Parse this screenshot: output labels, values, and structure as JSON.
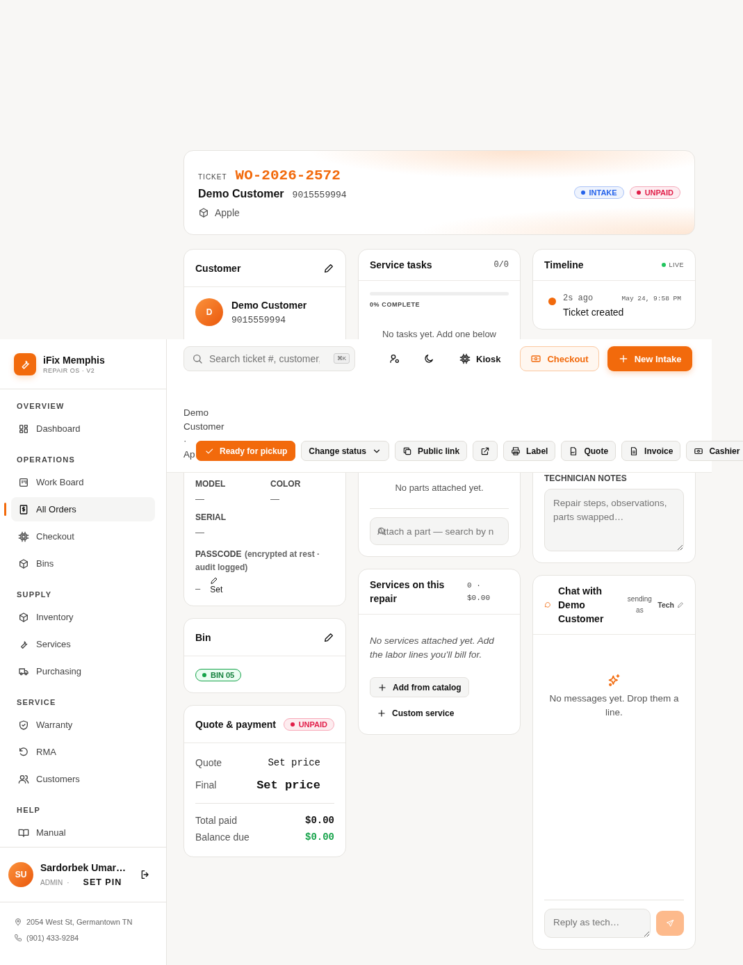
{
  "ticket": {
    "label": "TICKET",
    "number": "WO-2026-2572",
    "customer": "Demo Customer",
    "phone": "9015559994",
    "brand": "Apple",
    "badges": [
      {
        "text": "INTAKE",
        "color": "#2563eb"
      },
      {
        "text": "UNPAID",
        "color": "#e11d48"
      }
    ]
  },
  "customer_card": {
    "title": "Customer",
    "avatar": "D",
    "name": "Demo Customer",
    "phone": "9015559994",
    "fields": [
      {
        "label": "MODEL",
        "value": "—"
      },
      {
        "label": "COLOR",
        "value": "—"
      },
      {
        "label": "SERIAL",
        "value": "—"
      }
    ],
    "passcode": {
      "label": "PASSCODE",
      "note": "(encrypted at rest · audit logged)",
      "value": "–",
      "action": "Set"
    }
  },
  "tasks_card": {
    "title": "Service tasks",
    "count": "0/0",
    "level": 0,
    "progress_label": "0% COMPLETE",
    "empty": "No tasks yet. Add one below",
    "parts_empty": "No parts attached yet.",
    "parts_placeholder": "Attach a part — search by n"
  },
  "timeline": {
    "title": "Timeline",
    "live": "LIVE",
    "events": [
      {
        "ago": "2s ago",
        "time": "May 24, 9:58 PM",
        "text": "Ticket created"
      }
    ]
  },
  "notes": {
    "label": "TECHNICIAN NOTES",
    "placeholder": "Repair steps, observations, parts swapped…"
  },
  "bin": {
    "title": "Bin",
    "tag": "BIN 05"
  },
  "quote": {
    "title": "Quote & payment",
    "badge": "UNPAID",
    "rows": [
      {
        "label": "Quote",
        "value": "Set price",
        "kind": "plain"
      },
      {
        "label": "Final",
        "value": "Set price",
        "kind": "strong"
      }
    ],
    "totals": [
      {
        "label": "Total paid",
        "value": "$0.00",
        "kind": "plain"
      },
      {
        "label": "Balance due",
        "value": "$0.00",
        "kind": "positive"
      }
    ]
  },
  "services": {
    "title": "Services on this repair",
    "count": "0",
    "separator": "·",
    "total": "$0.00",
    "empty": "No services attached yet. Add the labor lines you'll bill for.",
    "actions": [
      {
        "label": "Add from catalog",
        "kind": "outlined"
      },
      {
        "label": "Custom service",
        "kind": "plain"
      }
    ]
  },
  "chat": {
    "title": "Chat with Demo Customer",
    "sending_label": "sending as",
    "sender": "Tech",
    "empty": "No messages yet. Drop them a line.",
    "placeholder": "Reply as tech…"
  },
  "topbar": {
    "search_placeholder": "Search ticket #, customer,",
    "shortcut": "⌘K",
    "kiosk": "Kiosk",
    "checkout": "Checkout",
    "new_intake": "New Intake",
    "breadcrumb": [
      "Demo Customer",
      "·",
      "Ap"
    ],
    "actions": [
      {
        "label": "Ready for pickup",
        "kind": "primary"
      },
      {
        "label": "Change status",
        "kind": "dropdown"
      },
      {
        "label": "Public link",
        "kind": "default"
      },
      {
        "kind": "icon"
      },
      {
        "label": "Label",
        "kind": "default"
      },
      {
        "label": "Quote",
        "kind": "default"
      },
      {
        "label": "Invoice",
        "kind": "default"
      },
      {
        "label": "Cashier",
        "kind": "default"
      }
    ]
  },
  "sidebar": {
    "brand": "iFix Memphis",
    "subtitle": "REPAIR OS · V2",
    "sections": [
      {
        "title": "OVERVIEW",
        "items": [
          {
            "label": "Dashboard",
            "selected": false
          }
        ]
      },
      {
        "title": "OPERATIONS",
        "items": [
          {
            "label": "Work Board",
            "selected": false
          },
          {
            "label": "All Orders",
            "selected": true
          },
          {
            "label": "Checkout",
            "selected": false
          },
          {
            "label": "Bins",
            "selected": false
          }
        ]
      },
      {
        "title": "SUPPLY",
        "items": [
          {
            "label": "Inventory",
            "selected": false
          },
          {
            "label": "Services",
            "selected": false
          },
          {
            "label": "Purchasing",
            "selected": false
          }
        ]
      },
      {
        "title": "SERVICE",
        "items": [
          {
            "label": "Warranty",
            "selected": false
          },
          {
            "label": "RMA",
            "selected": false
          },
          {
            "label": "Customers",
            "selected": false
          }
        ]
      },
      {
        "title": "HELP",
        "items": [
          {
            "label": "Manual",
            "selected": false
          }
        ]
      }
    ],
    "user": {
      "initials": "SU",
      "name": "Sardorbek Umar…",
      "role": "ADMIN",
      "separator": "·",
      "action": "SET PIN"
    },
    "address": "2054 West St, Germantown TN",
    "phone": "(901) 433-9284"
  }
}
